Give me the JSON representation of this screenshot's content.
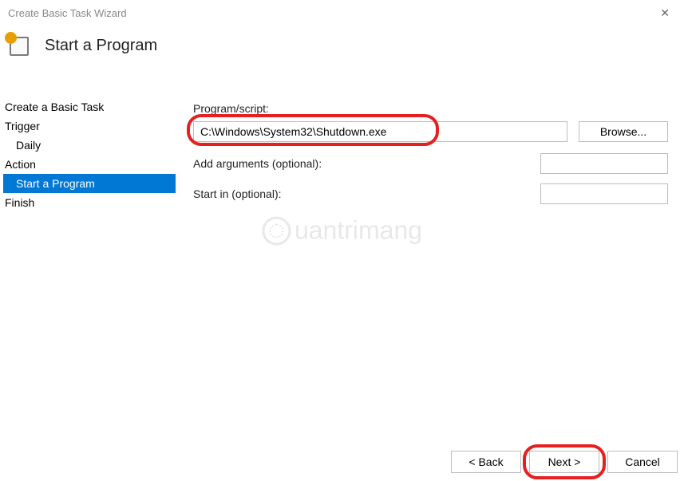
{
  "window": {
    "title": "Create Basic Task Wizard"
  },
  "header": {
    "title": "Start a Program"
  },
  "sidebar": {
    "items": [
      {
        "label": "Create a Basic Task",
        "type": "item",
        "selected": false
      },
      {
        "label": "Trigger",
        "type": "item",
        "selected": false
      },
      {
        "label": "Daily",
        "type": "subitem",
        "selected": false
      },
      {
        "label": "Action",
        "type": "item",
        "selected": false
      },
      {
        "label": "Start a Program",
        "type": "subitem",
        "selected": true
      },
      {
        "label": "Finish",
        "type": "item",
        "selected": false
      }
    ]
  },
  "form": {
    "program_label": "Program/script:",
    "program_value": "C:\\Windows\\System32\\Shutdown.exe",
    "browse_label": "Browse...",
    "arguments_label": "Add arguments (optional):",
    "arguments_value": "",
    "startin_label": "Start in (optional):",
    "startin_value": ""
  },
  "footer": {
    "back_label": "< Back",
    "next_label": "Next >",
    "cancel_label": "Cancel"
  },
  "watermark": {
    "text": "uantrimang"
  },
  "annotations": {
    "highlight_program_input": true,
    "highlight_next_button": true,
    "color": "#e62020"
  }
}
